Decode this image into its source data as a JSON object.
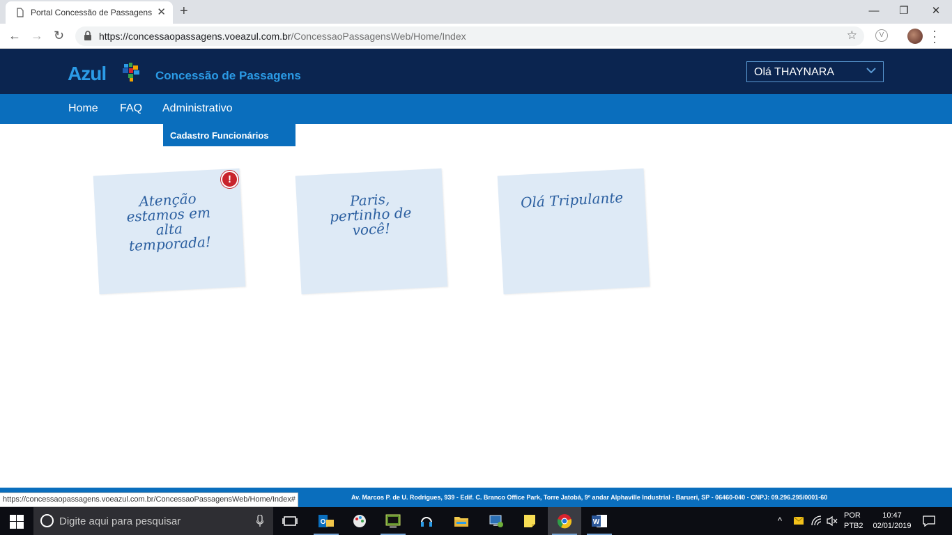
{
  "browser": {
    "tab_title": "Portal Concessão de Passagens",
    "url_host": "https://concessaopassagens.voeazul.com.br",
    "url_path": "/ConcessaoPassagensWeb/Home/Index",
    "status_url": "https://concessaopassagens.voeazul.com.br/ConcessaoPassagensWeb/Home/Index#"
  },
  "header": {
    "logo_text": "Azul",
    "site_title": "Concessão de Passagens",
    "user_greeting": "Olá THAYNARA"
  },
  "nav": {
    "items": [
      {
        "label": "Home"
      },
      {
        "label": "FAQ"
      },
      {
        "label": "Administrativo"
      }
    ],
    "dropdown_item": "Cadastro Funcionários"
  },
  "notes": [
    {
      "lines": [
        "Atenção",
        "estamos em",
        "alta",
        "temporada!"
      ],
      "alert": true
    },
    {
      "lines": [
        "Paris,",
        "pertinho de",
        "você!"
      ],
      "alert": false
    },
    {
      "lines": [
        "Olá Tripulante"
      ],
      "alert": false
    }
  ],
  "footer": {
    "address": "Av. Marcos P. de U. Rodrigues, 939 - Edif. C. Branco Office Park, Torre Jatobá, 9º andar Alphaville Industrial - Barueri, SP - 06460-040 - CNPJ: 09.296.295/0001-60"
  },
  "taskbar": {
    "search_placeholder": "Digite aqui para pesquisar",
    "language_1": "POR",
    "language_2": "PTB2",
    "time": "10:47",
    "date": "02/01/2019"
  },
  "colors": {
    "header_bg": "#0b2550",
    "nav_bg": "#0a6ebd",
    "brand_blue": "#2b9be6",
    "note_bg": "#deeaf6",
    "alert_red": "#c8232c"
  }
}
